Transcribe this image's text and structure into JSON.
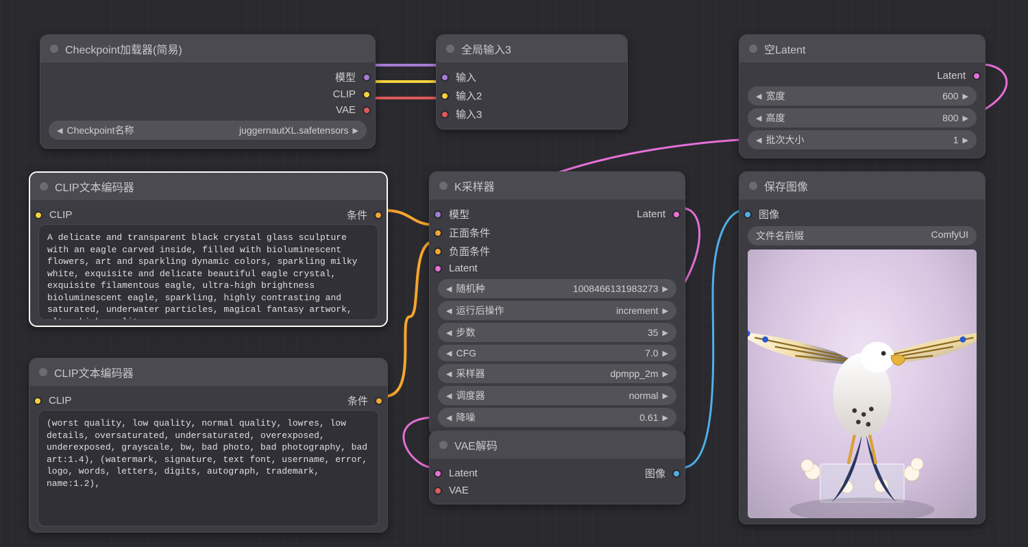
{
  "nodes": {
    "checkpoint": {
      "title": "Checkpoint加载器(简易)",
      "outputs": {
        "model": "模型",
        "clip": "CLIP",
        "vae": "VAE"
      },
      "widget_label": "Checkpoint名称",
      "widget_value": "juggernautXL.safetensors"
    },
    "reroute": {
      "title": "全局输入3",
      "inputs": {
        "in1": "输入",
        "in2": "输入2",
        "in3": "输入3"
      }
    },
    "empty_latent": {
      "title": "空Latent",
      "output": "Latent",
      "width_label": "宽度",
      "width_value": "600",
      "height_label": "高度",
      "height_value": "800",
      "batch_label": "批次大小",
      "batch_value": "1"
    },
    "clip_pos": {
      "title": "CLIP文本编码器",
      "in_label": "CLIP",
      "out_label": "条件",
      "text": "A delicate and transparent black crystal glass sculpture with an eagle carved inside, filled with bioluminescent flowers, art and sparkling dynamic colors, sparkling milky white, exquisite and delicate beautiful eagle crystal, exquisite filamentous eagle, ultra-high brightness bioluminescent eagle, sparkling, highly contrasting and saturated, underwater particles, magical fantasy artwork, ultra-high quality"
    },
    "clip_neg": {
      "title": "CLIP文本编码器",
      "in_label": "CLIP",
      "out_label": "条件",
      "text": "(worst quality, low quality, normal quality, lowres, low details, oversaturated, undersaturated, overexposed, underexposed, grayscale, bw, bad photo, bad photography, bad art:1.4), (watermark, signature, text font, username, error, logo, words, letters, digits, autograph, trademark, name:1.2),"
    },
    "ksampler": {
      "title": "K采样器",
      "in_model": "模型",
      "in_pos": "正面条件",
      "in_neg": "负面条件",
      "in_latent": "Latent",
      "out_latent": "Latent",
      "seed_label": "随机种",
      "seed_value": "1008466131983273",
      "after_label": "运行后操作",
      "after_value": "increment",
      "steps_label": "步数",
      "steps_value": "35",
      "cfg_label": "CFG",
      "cfg_value": "7.0",
      "sampler_label": "采样器",
      "sampler_value": "dpmpp_2m",
      "scheduler_label": "调度器",
      "scheduler_value": "normal",
      "denoise_label": "降噪",
      "denoise_value": "0.61"
    },
    "vae_decode": {
      "title": "VAE解码",
      "in_latent": "Latent",
      "in_vae": "VAE",
      "out_image": "图像"
    },
    "save_image": {
      "title": "保存图像",
      "in_image": "图像",
      "prefix_label": "文件名前缀",
      "prefix_value": "ComfyUI"
    }
  }
}
